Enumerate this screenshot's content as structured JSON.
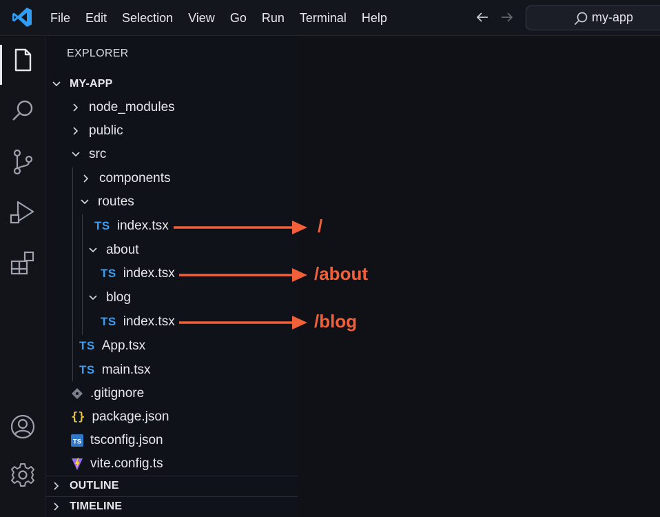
{
  "titlebar": {
    "menu": [
      "File",
      "Edit",
      "Selection",
      "View",
      "Go",
      "Run",
      "Terminal",
      "Help"
    ],
    "search_text": "my-app"
  },
  "explorer": {
    "title": "EXPLORER",
    "project": "MY-APP",
    "items": {
      "node_modules": "node_modules",
      "public": "public",
      "src": "src",
      "components": "components",
      "routes": "routes",
      "routes_index": "index.tsx",
      "about": "about",
      "about_index": "index.tsx",
      "blog": "blog",
      "blog_index": "index.tsx",
      "app": "App.tsx",
      "main": "main.tsx",
      "gitignore": ".gitignore",
      "package": "package.json",
      "tsconfig": "tsconfig.json",
      "vite": "vite.config.ts"
    },
    "ts_badge": "TS",
    "outline": "OUTLINE",
    "timeline": "TIMELINE"
  },
  "annotations": {
    "route_root": "/",
    "route_about": "/about",
    "route_blog": "/blog"
  },
  "colors": {
    "accent_arrow": "#f2603a",
    "ts_blue": "#3b9cf0",
    "vscode_blue": "#2f9df4"
  },
  "icons": {
    "activity": [
      "explorer-icon",
      "search-icon",
      "source-control-icon",
      "run-debug-icon",
      "extensions-icon",
      "account-icon",
      "settings-gear-icon"
    ]
  }
}
